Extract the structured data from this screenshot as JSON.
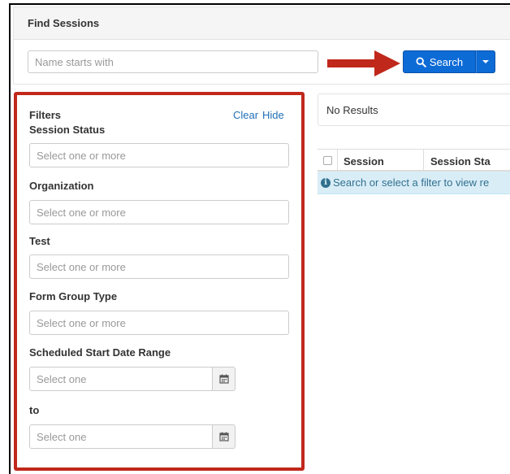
{
  "header": {
    "title": "Find Sessions",
    "search_placeholder": "Name starts with",
    "search_button_label": "Search"
  },
  "filters": {
    "title": "Filters",
    "clear_label": "Clear",
    "hide_label": "Hide",
    "fields": [
      {
        "label": "Session Status",
        "placeholder": "Select one or more"
      },
      {
        "label": "Organization",
        "placeholder": "Select one or more"
      },
      {
        "label": "Test",
        "placeholder": "Select one or more"
      },
      {
        "label": "Form Group Type",
        "placeholder": "Select one or more"
      }
    ],
    "date_range": {
      "label": "Scheduled Start Date Range",
      "start_placeholder": "Select one",
      "to_label": "to",
      "end_placeholder": "Select one"
    }
  },
  "results": {
    "status_text": "No Results",
    "columns": [
      "Session",
      "Session Sta"
    ],
    "info_message": "Search or select a filter to view re"
  },
  "icons": {
    "search": "search-icon",
    "caret": "chevron-down-icon",
    "calendar": "calendar-icon",
    "info": "info-icon",
    "annotation": "arrow-right-icon"
  },
  "colors": {
    "primary_button": "#0d6bd6",
    "link": "#1f6fb5",
    "highlight_border": "#c0281b",
    "annotation_arrow": "#c0281b",
    "info_background": "#d9edf7",
    "info_text": "#31708f"
  }
}
